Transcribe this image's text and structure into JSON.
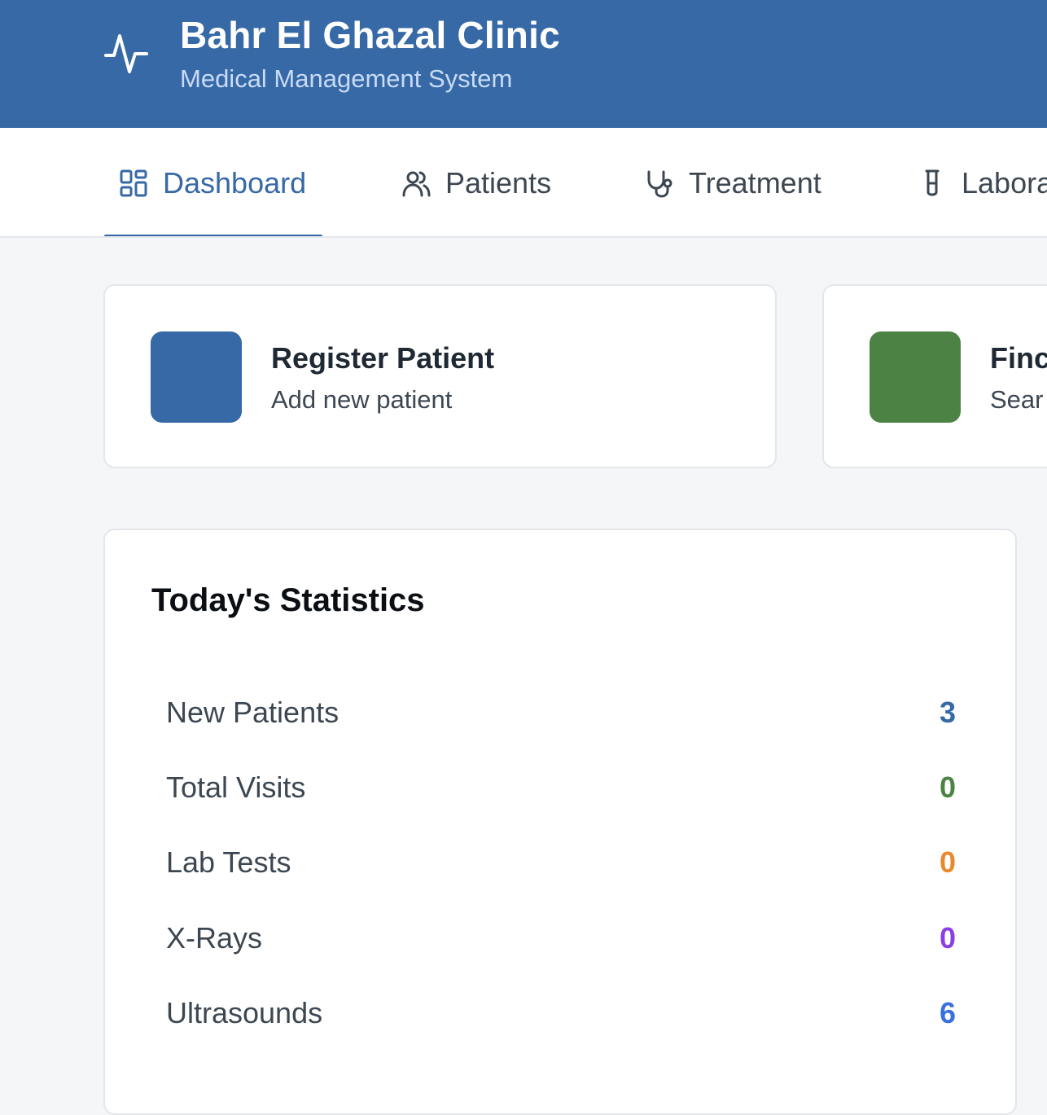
{
  "header": {
    "title": "Bahr El Ghazal Clinic",
    "subtitle": "Medical Management System",
    "logo_icon": "activity-pulse-icon"
  },
  "nav": {
    "tabs": [
      {
        "label": "Dashboard",
        "icon": "dashboard-grid-icon",
        "active": true
      },
      {
        "label": "Patients",
        "icon": "users-icon",
        "active": false
      },
      {
        "label": "Treatment",
        "icon": "stethoscope-icon",
        "active": false
      },
      {
        "label": "Labora",
        "icon": "test-tube-icon",
        "active": false
      }
    ]
  },
  "actions": [
    {
      "title": "Register Patient",
      "subtitle": "Add new patient",
      "color": "#3669a6"
    },
    {
      "title": "Finc",
      "subtitle": "Sear",
      "color": "#4c8244"
    }
  ],
  "stats": {
    "title": "Today's Statistics",
    "rows": [
      {
        "label": "New Patients",
        "value": "3",
        "color": "#3669a6"
      },
      {
        "label": "Total Visits",
        "value": "0",
        "color": "#4c8244"
      },
      {
        "label": "Lab Tests",
        "value": "0",
        "color": "#e8892b"
      },
      {
        "label": "X-Rays",
        "value": "0",
        "color": "#8a3fe6"
      },
      {
        "label": "Ultrasounds",
        "value": "6",
        "color": "#3a6fe0"
      }
    ]
  },
  "colors": {
    "primary": "#3669a6",
    "background": "#f5f6f8"
  }
}
